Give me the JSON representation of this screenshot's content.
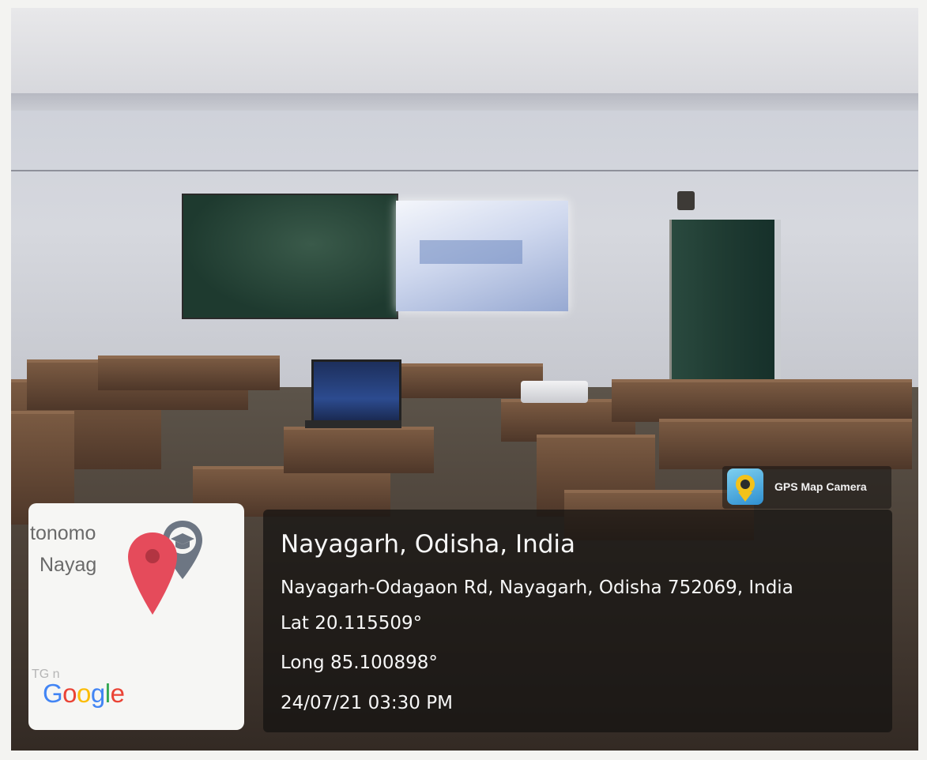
{
  "map_thumbnail": {
    "partial_text_line1": "tonomo",
    "partial_text_line2": "Nayag",
    "faint_label": "TG n",
    "logo_text": "Google",
    "logo_colors": [
      "#4285F4",
      "#EA4335",
      "#FBBC05",
      "#4285F4",
      "#34A853",
      "#EA4335"
    ],
    "pin_icon": "location-pin-icon",
    "pin_color": "#e54b5b",
    "poi_icon": "graduation-cap-icon"
  },
  "app_badge": {
    "name": "GPS Map Camera",
    "icon": "gps-map-camera-icon"
  },
  "location": {
    "title": "Nayagarh, Odisha, India",
    "address": "Nayagarh-Odagaon Rd, Nayagarh, Odisha 752069, India",
    "latitude": "Lat 20.115509°",
    "longitude": "Long 85.100898°",
    "datetime": "24/07/21 03:30 PM"
  },
  "scene": {
    "description_colors": {
      "blackboard": "#1e3a2f",
      "projection_screen": "#cfd8ee",
      "desk_wood": "#7a5a42",
      "overlay": "#141211"
    }
  }
}
